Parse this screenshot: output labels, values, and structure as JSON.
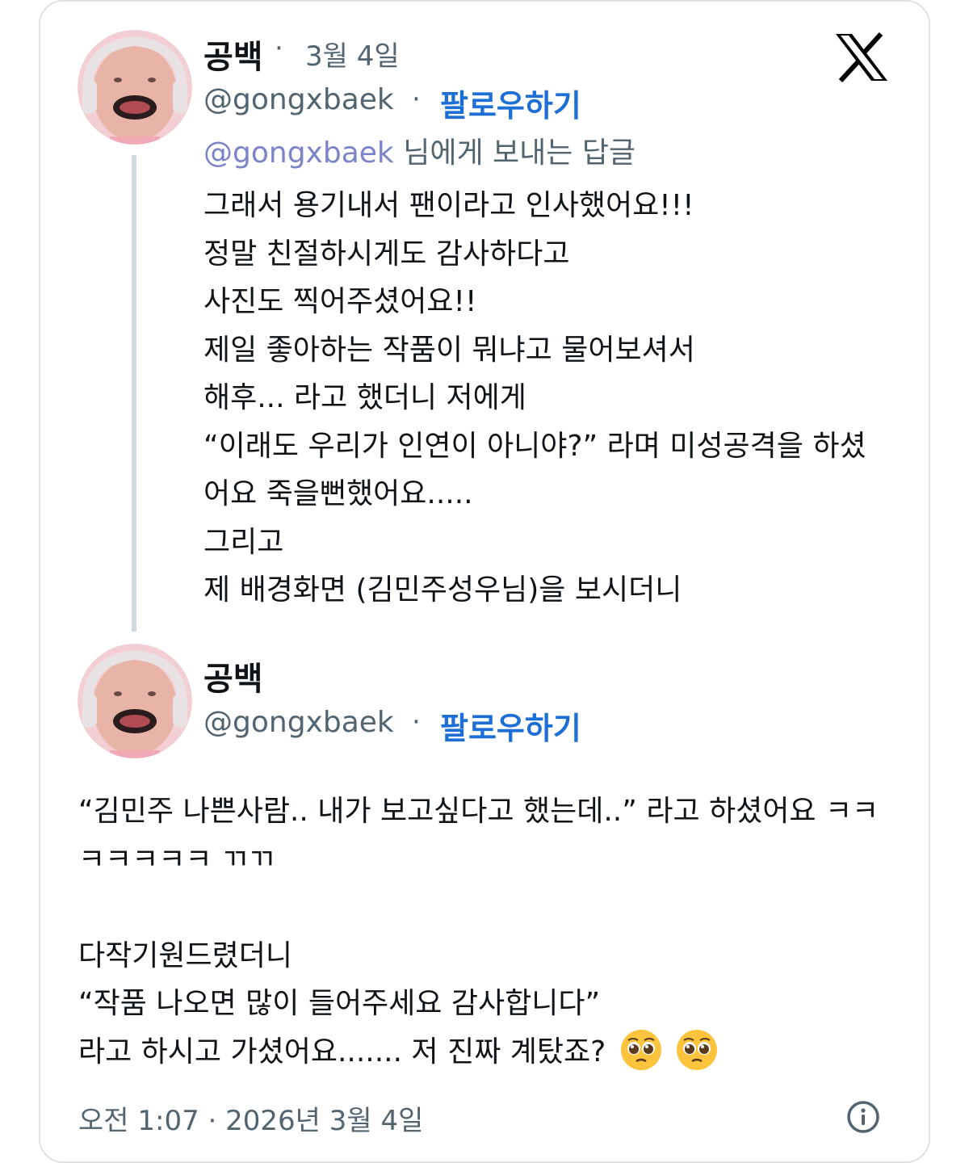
{
  "reply_tweet": {
    "author_name": "공백",
    "separator": "·",
    "date": "3월 4일",
    "handle": "@gongxbaek",
    "follow_label": "팔로우하기",
    "replying_to_handle": "@gongxbaek",
    "replying_to_suffix": " 님에게 보내는 답글",
    "lines": [
      "그래서 용기내서 팬이라고 인사했어요!!!",
      "정말 친절하시게도 감사하다고",
      "사진도 찍어주셨어요!!",
      "제일 좋아하는 작품이 뭐냐고 물어보셔서",
      "해후... 라고 했더니 저에게",
      "“이래도 우리가 인연이 아니야?” 라며 미성공격을 하셨",
      "어요 죽을뻔했어요.....",
      "그리고",
      "제 배경화면 (김민주성우님)을 보시더니"
    ]
  },
  "main_tweet": {
    "author_name": "공백",
    "separator": "·",
    "handle": "@gongxbaek",
    "follow_label": "팔로우하기",
    "lines": [
      "“김민주 나쁜사람.. 내가 보고싶다고 했는데..” 라고 하셨어요 ㅋㅋ",
      "ㅋㅋㅋㅋㅋ ㄲㄲ",
      "",
      "다작기원드렸더니",
      "“작품 나오면 많이 들어주세요 감사합니다”",
      "라고 하시고 가셨어요....... 저 진짜 계탔죠?"
    ],
    "emojis": [
      "pleading-face-emoji",
      "pleading-face-emoji"
    ],
    "timestamp": "오전 1:07 · 2026년 3월 4일"
  },
  "icons": {
    "x_logo": "x-logo-icon",
    "info": "info-icon"
  },
  "colors": {
    "follow": "#1d6fd6",
    "muted": "#536471",
    "mention": "#7b83c9",
    "thread_line": "#cfd9de"
  }
}
